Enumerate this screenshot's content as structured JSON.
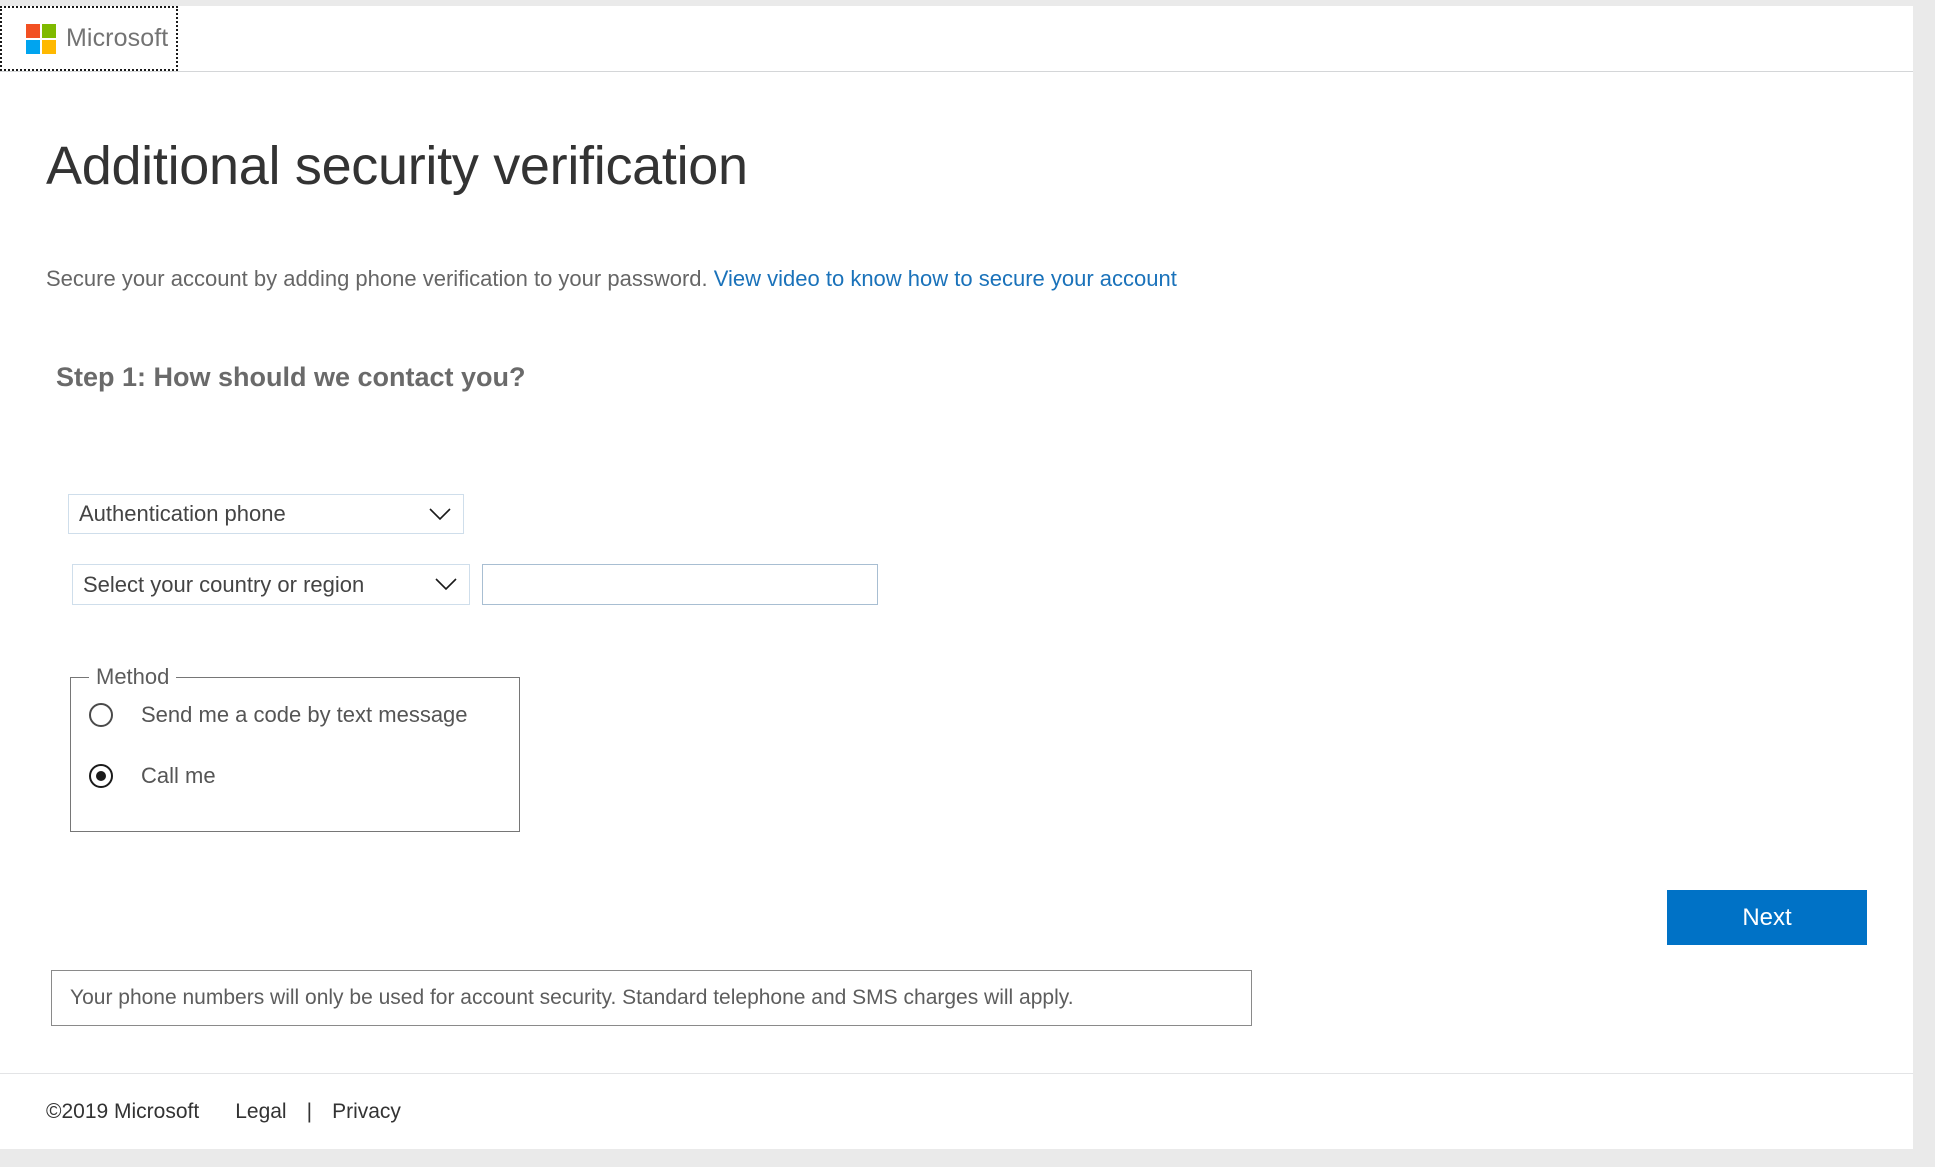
{
  "header": {
    "brand": "Microsoft",
    "logo_colors": {
      "red": "#F25022",
      "green": "#7FBA00",
      "blue": "#00A4EF",
      "yellow": "#FFB900"
    }
  },
  "main": {
    "title": "Additional security verification",
    "subtitle_text": "Secure your account by adding phone verification to your password.",
    "subtitle_link": "View video to know how to secure your account",
    "step_heading": "Step 1: How should we contact you?",
    "auth_method_select": {
      "value": "Authentication phone",
      "icon": "chevron-down-icon"
    },
    "country_select": {
      "value": "Select your country or region",
      "icon": "chevron-down-icon"
    },
    "phone_input": {
      "value": "",
      "placeholder": ""
    },
    "method_group": {
      "legend": "Method",
      "options": [
        {
          "label": "Send me a code by text message",
          "checked": false
        },
        {
          "label": "Call me",
          "checked": true
        }
      ]
    },
    "next_button": "Next",
    "disclaimer": "Your phone numbers will only be used for account security. Standard telephone and SMS charges will apply.",
    "accent_color": "#0072C6",
    "link_color": "#1A72BA"
  },
  "footer": {
    "copyright": "©2019 Microsoft",
    "legal": "Legal",
    "separator": "|",
    "privacy": "Privacy"
  }
}
